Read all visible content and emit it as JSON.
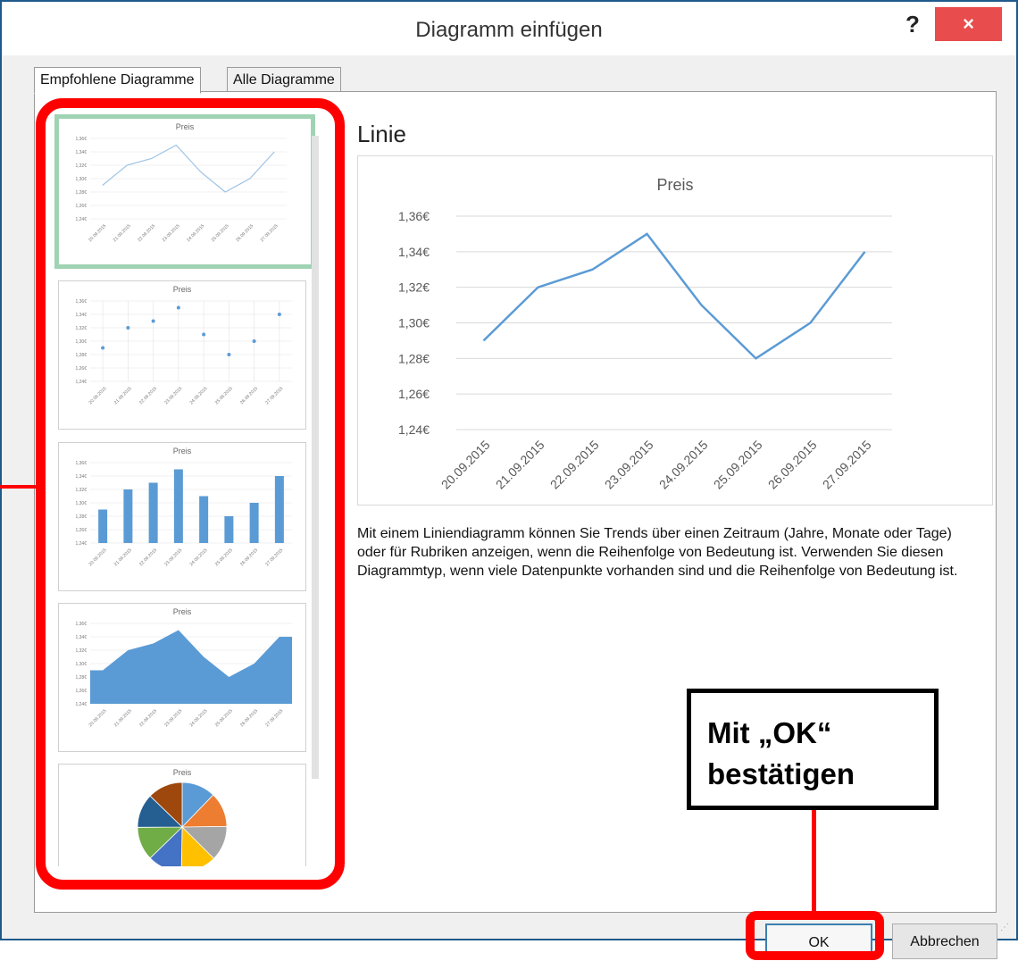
{
  "window": {
    "title": "Diagramm einfügen",
    "help_label": "?",
    "close_label": "×"
  },
  "tabs": [
    {
      "label": "Empfohlene Diagramme",
      "active": true
    },
    {
      "label": "Alle Diagramme",
      "active": false
    }
  ],
  "thumbnails": [
    {
      "type": "line",
      "title": "Preis",
      "selected": true
    },
    {
      "type": "scatter",
      "title": "Preis",
      "selected": false
    },
    {
      "type": "bar",
      "title": "Preis",
      "selected": false
    },
    {
      "type": "area",
      "title": "Preis",
      "selected": false
    },
    {
      "type": "pie",
      "title": "Preis",
      "selected": false
    }
  ],
  "preview": {
    "heading": "Linie",
    "description": "Mit einem Liniendiagramm können Sie Trends über einen Zeitraum (Jahre, Monate oder Tage) oder für Rubriken anzeigen, wenn die Reihenfolge von Bedeutung ist. Verwenden Sie diesen Diagrammtyp, wenn viele Datenpunkte vorhanden sind und die Reihenfolge von Bedeutung ist."
  },
  "chart_data": {
    "type": "line",
    "title": "Preis",
    "categories": [
      "20.09.2015",
      "21.09.2015",
      "22.09.2015",
      "23.09.2015",
      "24.09.2015",
      "25.09.2015",
      "26.09.2015",
      "27.09.2015"
    ],
    "values": [
      1.29,
      1.32,
      1.33,
      1.35,
      1.31,
      1.28,
      1.3,
      1.34
    ],
    "ylim": [
      1.24,
      1.36
    ],
    "yticks": [
      "1,24€",
      "1,26€",
      "1,28€",
      "1,30€",
      "1,32€",
      "1,34€",
      "1,36€"
    ],
    "grid": true,
    "color": "#5b9bd5"
  },
  "callout": {
    "line1": "Mit „OK“",
    "line2": "bestätigen"
  },
  "buttons": {
    "ok": "OK",
    "cancel": "Abbrechen"
  },
  "colors": {
    "highlight": "#ff0000",
    "selected_border": "#9fd3b3",
    "series": "#5b9bd5",
    "pie": [
      "#5b9bd5",
      "#ed7d31",
      "#a5a5a5",
      "#ffc000",
      "#4472c4",
      "#70ad47",
      "#255e91",
      "#9e480e"
    ]
  }
}
